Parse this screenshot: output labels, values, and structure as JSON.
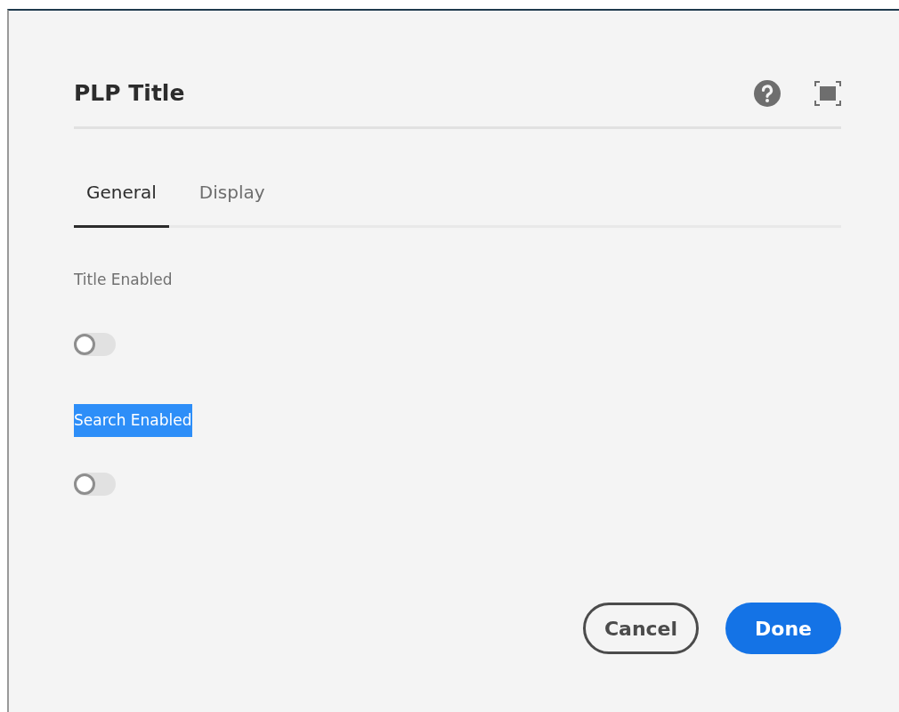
{
  "dialog": {
    "title": "PLP Title"
  },
  "tabs": [
    {
      "label": "General",
      "selected": true
    },
    {
      "label": "Display",
      "selected": false
    }
  ],
  "fields": [
    {
      "label": "Title Enabled",
      "highlighted": false,
      "on": false
    },
    {
      "label": "Search Enabled",
      "highlighted": true,
      "on": false
    }
  ],
  "buttons": [
    {
      "label": "Cancel",
      "kind": "secondary"
    },
    {
      "label": "Done",
      "kind": "primary"
    }
  ]
}
